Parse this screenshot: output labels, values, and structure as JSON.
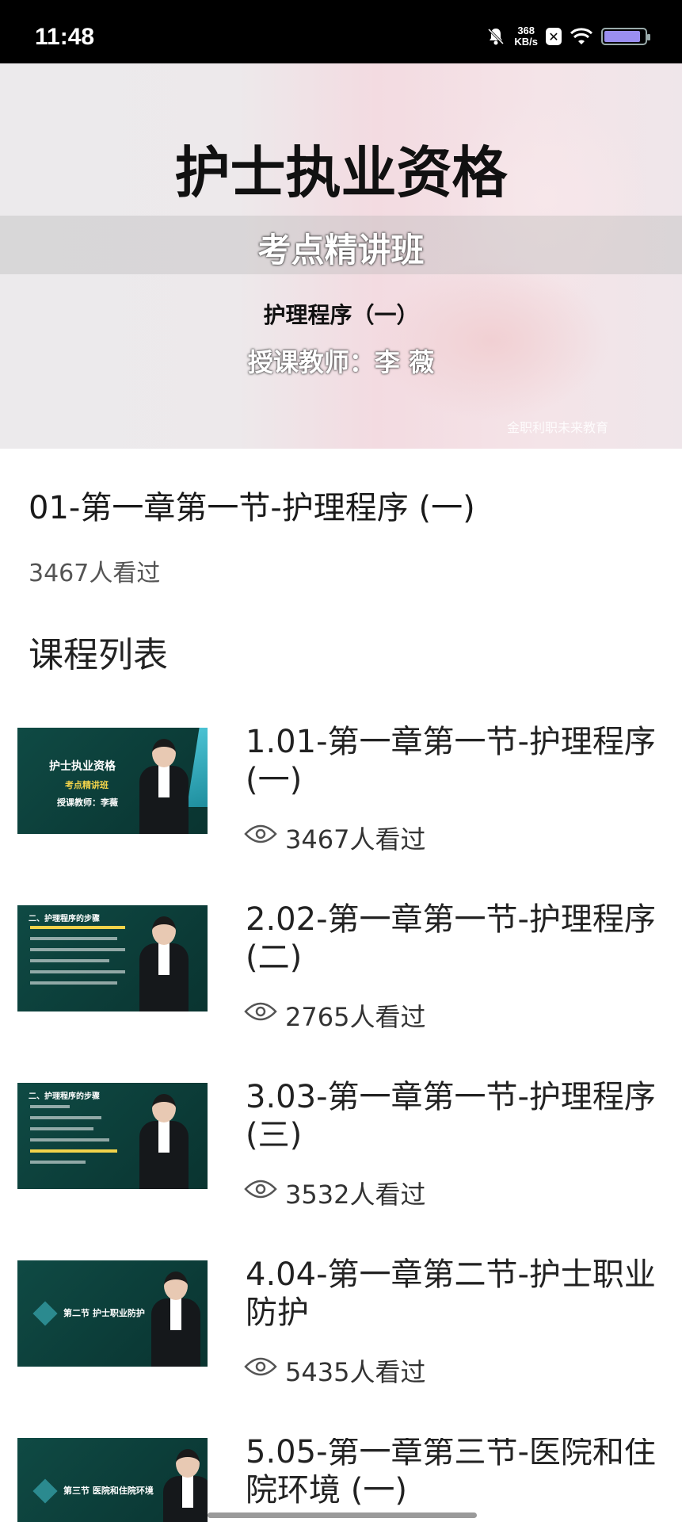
{
  "status_bar": {
    "time": "11:48",
    "net_speed_value": "368",
    "net_speed_unit": "KB/s",
    "battery_level": 0.9
  },
  "hero": {
    "title": "护士执业资格",
    "subtitle": "考点精讲班",
    "chapter": "护理程序（一）",
    "teacher": "授课教师：李  薇",
    "watermark": "金职利职未来教育"
  },
  "video": {
    "title": "01-第一章第一节-护理程序 (一)",
    "views": "3467人看过"
  },
  "section_title": "课程列表",
  "courses": [
    {
      "title": "1.01-第一章第一节-护理程序 (一)",
      "views": "3467人看过",
      "thumb_title": "护士执业资格",
      "thumb_subtitle": "考点精讲班",
      "thumb_teacher": "授课教师：李薇"
    },
    {
      "title": "2.02-第一章第一节-护理程序 (二)",
      "views": "2765人看过",
      "thumb_title": "二、护理程序的步骤"
    },
    {
      "title": "3.03-第一章第一节-护理程序 (三)",
      "views": "3532人看过",
      "thumb_title": "二、护理程序的步骤"
    },
    {
      "title": "4.04-第一章第二节-护士职业防护",
      "views": "5435人看过",
      "thumb_title": "第二节  护士职业防护"
    },
    {
      "title": "5.05-第一章第三节-医院和住院环境 (一)",
      "views": "",
      "thumb_title": "第三节  医院和住院环境"
    }
  ],
  "colors": {
    "thumb_bg": "#0f4a44",
    "accent_cyan": "#4ec5d6"
  }
}
